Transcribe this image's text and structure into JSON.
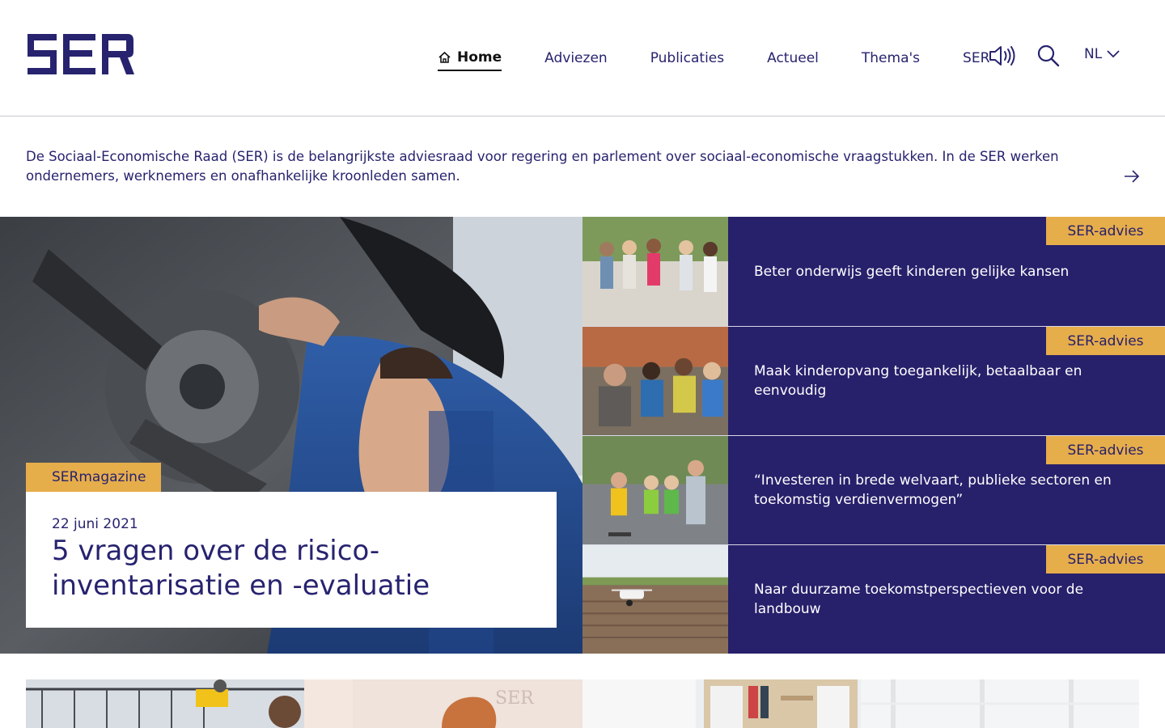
{
  "header": {
    "logo_text": "SER",
    "nav": [
      {
        "label": "Home",
        "active": true
      },
      {
        "label": "Adviezen"
      },
      {
        "label": "Publicaties"
      },
      {
        "label": "Actueel"
      },
      {
        "label": "Thema's"
      },
      {
        "label": "SER"
      }
    ],
    "icons": {
      "readspeaker": "speaker-icon",
      "search": "search-icon"
    },
    "language": "NL"
  },
  "intro": {
    "text": "De Sociaal-Economische Raad (SER) is de belangrijkste adviesraad voor regering en parlement over sociaal-economische vraagstukken. In de SER werken ondernemers, werknemers en onafhankelijke kroonleden samen."
  },
  "featured": {
    "tag": "SERmagazine",
    "date": "22 juni 2021",
    "title": "5 vragen over de risico-inventarisatie en -evaluatie"
  },
  "advice": [
    {
      "tag": "SER-advies",
      "title": "Beter onderwijs geeft kinderen gelijke kansen"
    },
    {
      "tag": "SER-advies",
      "title": "Maak kinderopvang toegankelijk, betaalbaar en eenvoudig"
    },
    {
      "tag": "SER-advies",
      "title": "“Investeren in brede welvaart, publieke sectoren en toekomstig verdienvermogen”"
    },
    {
      "tag": "SER-advies",
      "title": "Naar duurzame toekomstperspectieven voor de landbouw"
    }
  ],
  "colors": {
    "brand_navy": "#27206b",
    "accent_gold": "#e6ad4b",
    "background": "#ffffff"
  }
}
